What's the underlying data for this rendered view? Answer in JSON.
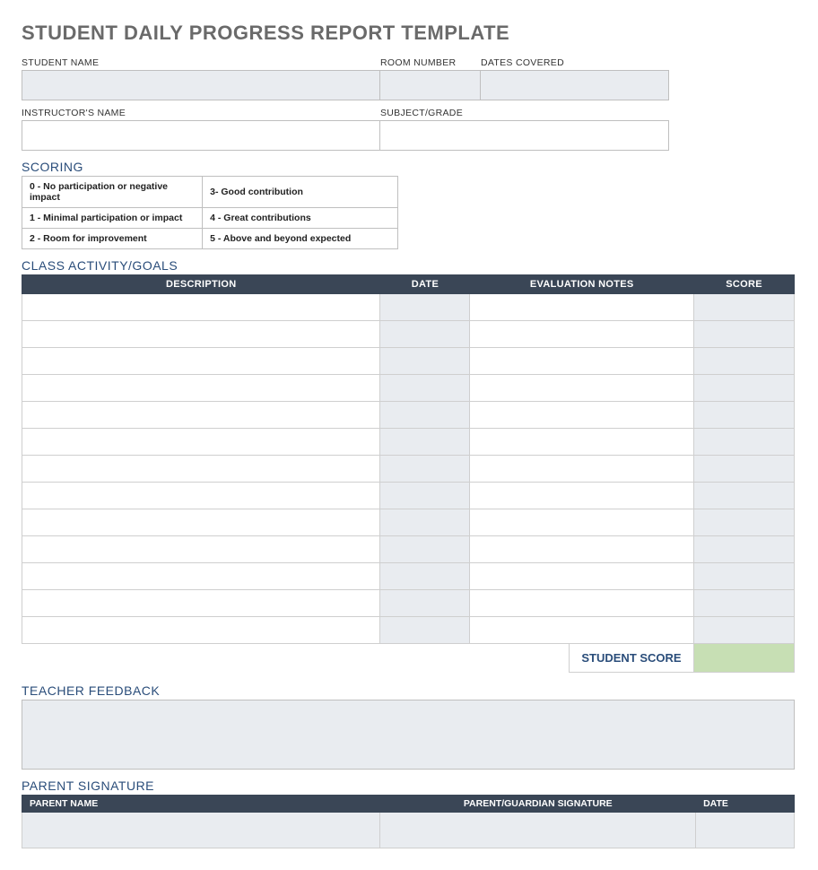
{
  "title": "STUDENT DAILY PROGRESS REPORT TEMPLATE",
  "fields": {
    "student_name_label": "STUDENT NAME",
    "room_number_label": "ROOM NUMBER",
    "dates_covered_label": "DATES COVERED",
    "instructor_name_label": "INSTRUCTOR'S NAME",
    "subject_grade_label": "SUBJECT/GRADE"
  },
  "scoring": {
    "heading": "SCORING",
    "rows": [
      {
        "left": "0 - No participation or negative impact",
        "right": "3- Good contribution"
      },
      {
        "left": "1 - Minimal participation or impact",
        "right": "4 - Great contributions"
      },
      {
        "left": "2 - Room for improvement",
        "right": "5 - Above and beyond expected"
      }
    ]
  },
  "activity": {
    "heading": "CLASS ACTIVITY/GOALS",
    "headers": {
      "description": "DESCRIPTION",
      "date": "DATE",
      "evaluation_notes": "EVALUATION NOTES",
      "score": "SCORE"
    },
    "row_count": 13
  },
  "student_score_label": "STUDENT SCORE",
  "teacher_feedback_heading": "TEACHER FEEDBACK",
  "parent_signature": {
    "heading": "PARENT SIGNATURE",
    "headers": {
      "parent_name": "PARENT NAME",
      "signature": "PARENT/GUARDIAN SIGNATURE",
      "date": "DATE"
    }
  }
}
